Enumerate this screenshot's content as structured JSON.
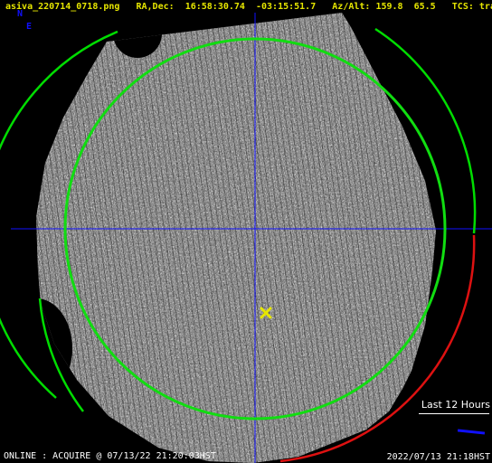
{
  "header": {
    "filename": "asiva_220714_0718.png",
    "radec_label": "RA,Dec:",
    "ra": "16:58:30.74",
    "dec": "-03:15:51.7",
    "azalt_label": "Az/Alt:",
    "az": "159.8",
    "alt": "65.5",
    "tcs_label": "TCS:",
    "tcs_state": "track"
  },
  "compass": {
    "north": "N",
    "east": "E"
  },
  "legend": {
    "label": "Last 12 Hours"
  },
  "status": {
    "left": "ONLINE : ACQUIRE @ 07/13/22 21:20:03HST",
    "right": "2022/07/13 21:18HST"
  },
  "colors": {
    "header_text": "#e6e600",
    "compass": "#1010ff",
    "crosshair": "#1010ff",
    "horizon_circle": "#00dd00",
    "elevation_circle": "#11dd11",
    "history_arc": "#dd1111",
    "target_marker": "#e6e600",
    "background": "#000000"
  },
  "icons": {
    "target_marker": "x-marker-icon"
  }
}
